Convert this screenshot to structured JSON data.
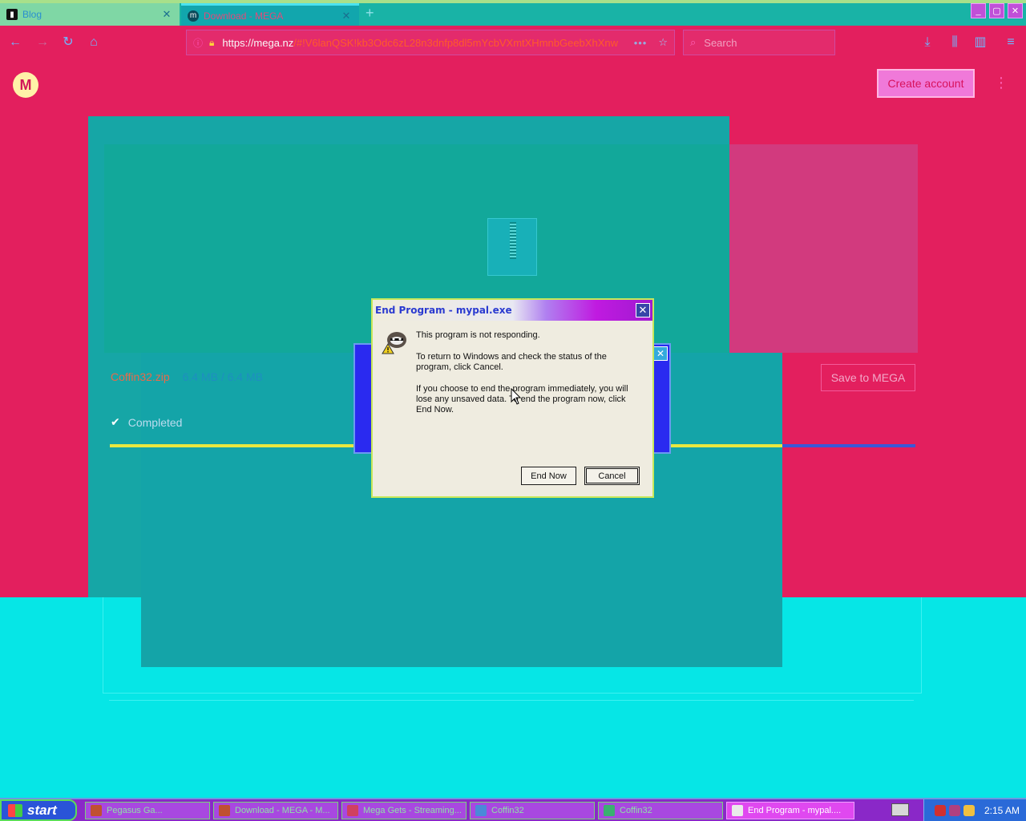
{
  "browser": {
    "tabs": [
      {
        "label": "Blog",
        "active": false
      },
      {
        "label": "Download - MEGA",
        "active": true
      }
    ],
    "url": {
      "host": "https://mega.nz",
      "path": "/#!V6lanQSK!kb3Odc6zL28n3dnfp8dl5mYcbVXmtXHmnbGeebXhXnw"
    },
    "search_placeholder": "Search"
  },
  "mega": {
    "logo_letter": "M",
    "create_account_label": "Create account",
    "file_name": "Coffin32.zip",
    "file_size": "6.4 MB / 6.4 MB",
    "status": "Completed",
    "progress": 1.0,
    "save_label": "Save to MEGA"
  },
  "dialog": {
    "title": "End Program - mypal.exe",
    "message_1": "This program is not responding.",
    "message_2": "To return to Windows and check the status of the program, click Cancel.",
    "message_3": "If you choose to end the program immediately, you will lose any unsaved data. To end the program now, click End Now.",
    "end_now_label": "End Now",
    "cancel_label": "Cancel"
  },
  "taskbar": {
    "start_label": "start",
    "tasks": [
      {
        "label": "Pegasus Ga...",
        "active": false
      },
      {
        "label": "Download - MEGA - M...",
        "active": false
      },
      {
        "label": "Mega Gets - Streaming...",
        "active": false
      },
      {
        "label": "Coffin32",
        "active": false
      },
      {
        "label": "Coffin32",
        "active": false
      },
      {
        "label": "End Program - mypal....",
        "active": true
      }
    ],
    "clock": "2:15 AM"
  },
  "colors": {
    "page_bg": "#e31f5e",
    "card_teal": "#16a6a6",
    "progress_fill": "#e8e840",
    "dialog_bg": "#efece0"
  }
}
